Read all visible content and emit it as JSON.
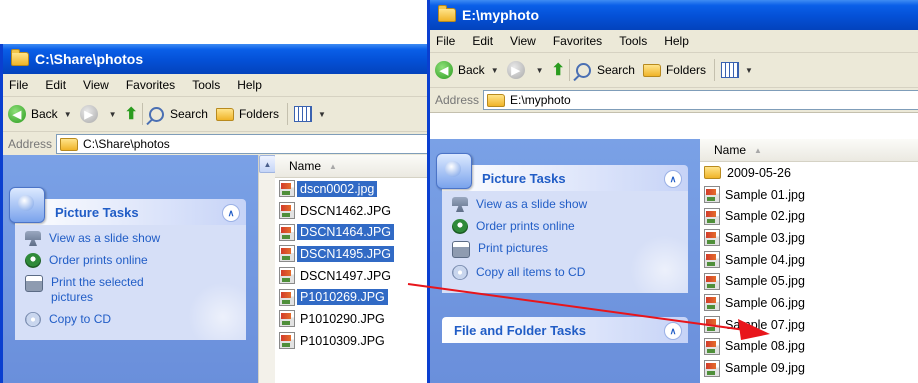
{
  "windows": [
    {
      "id": "w1",
      "title": "C:\\Share\\photos",
      "menu": [
        "File",
        "Edit",
        "View",
        "Favorites",
        "Tools",
        "Help"
      ],
      "toolbar": {
        "back": "Back",
        "search": "Search",
        "folders": "Folders"
      },
      "address": {
        "label": "Address",
        "path": "C:\\Share\\photos"
      },
      "panels": [
        {
          "title": "Picture Tasks",
          "tasks": [
            {
              "label": "View as a slide show",
              "icon": "slideshow-icon"
            },
            {
              "label": "Order prints online",
              "icon": "order-prints-icon"
            },
            {
              "label": "Print the selected pictures",
              "icon": "printer-icon"
            },
            {
              "label": "Copy to CD",
              "icon": "cd-icon"
            }
          ]
        }
      ],
      "column": "Name",
      "files": [
        {
          "name": "dscn0002.jpg",
          "type": "jpg",
          "selected": true
        },
        {
          "name": "DSCN1462.JPG",
          "type": "jpg",
          "selected": false
        },
        {
          "name": "DSCN1464.JPG",
          "type": "jpg",
          "selected": true
        },
        {
          "name": "DSCN1495.JPG",
          "type": "jpg",
          "selected": true
        },
        {
          "name": "DSCN1497.JPG",
          "type": "jpg",
          "selected": false
        },
        {
          "name": "P1010269.JPG",
          "type": "jpg",
          "selected": true
        },
        {
          "name": "P1010290.JPG",
          "type": "jpg",
          "selected": false
        },
        {
          "name": "P1010309.JPG",
          "type": "jpg",
          "selected": false
        }
      ]
    },
    {
      "id": "w2",
      "title": "E:\\myphoto",
      "menu": [
        "File",
        "Edit",
        "View",
        "Favorites",
        "Tools",
        "Help"
      ],
      "toolbar": {
        "back": "Back",
        "search": "Search",
        "folders": "Folders"
      },
      "address": {
        "label": "Address",
        "path": "E:\\myphoto"
      },
      "panels": [
        {
          "title": "Picture Tasks",
          "tasks": [
            {
              "label": "View as a slide show",
              "icon": "slideshow-icon"
            },
            {
              "label": "Order prints online",
              "icon": "order-prints-icon"
            },
            {
              "label": "Print pictures",
              "icon": "printer-icon"
            },
            {
              "label": "Copy all items to CD",
              "icon": "cd-icon"
            }
          ]
        },
        {
          "title": "File and Folder Tasks",
          "tasks": []
        }
      ],
      "column": "Name",
      "files": [
        {
          "name": "2009-05-26",
          "type": "folder",
          "selected": false
        },
        {
          "name": "Sample 01.jpg",
          "type": "jpg",
          "selected": false
        },
        {
          "name": "Sample 02.jpg",
          "type": "jpg",
          "selected": false
        },
        {
          "name": "Sample 03.jpg",
          "type": "jpg",
          "selected": false
        },
        {
          "name": "Sample 04.jpg",
          "type": "jpg",
          "selected": false
        },
        {
          "name": "Sample 05.jpg",
          "type": "jpg",
          "selected": false
        },
        {
          "name": "Sample 06.jpg",
          "type": "jpg",
          "selected": false
        },
        {
          "name": "Sample 07.jpg",
          "type": "jpg",
          "selected": false
        },
        {
          "name": "Sample 08.jpg",
          "type": "jpg",
          "selected": false
        },
        {
          "name": "Sample 09.jpg",
          "type": "jpg",
          "selected": false
        }
      ]
    }
  ],
  "colors": {
    "selection": "#316ac5",
    "titlebar": "#0450d6",
    "task_link": "#215dc6",
    "arrow": "#e8151b"
  }
}
